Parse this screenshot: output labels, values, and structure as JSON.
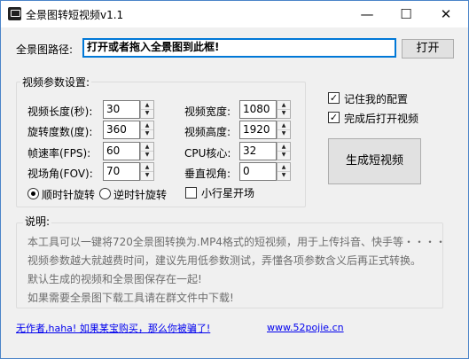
{
  "window": {
    "title": "全景图转短视频v1.1",
    "minimize": "—",
    "maximize": "☐",
    "close": "✕"
  },
  "path": {
    "label": "全景图路径:",
    "value": "打开或者拖入全景图到此框!",
    "open_button": "打开"
  },
  "params": {
    "title": "视频参数设置:",
    "video_length": {
      "label": "视频长度(秒):",
      "value": "30"
    },
    "rotation": {
      "label": "旋转度数(度):",
      "value": "360"
    },
    "fps": {
      "label": "帧速率(FPS):",
      "value": "60"
    },
    "fov": {
      "label": "视场角(FOV):",
      "value": "70"
    },
    "video_width": {
      "label": "视频宽度:",
      "value": "1080"
    },
    "video_height": {
      "label": "视频高度:",
      "value": "1920"
    },
    "cpu_cores": {
      "label": "CPU核心:",
      "value": "32"
    },
    "vertical_angle": {
      "label": "垂直视角:",
      "value": "0"
    },
    "clockwise": "顺时针旋转",
    "counterclockwise": "逆时针旋转",
    "little_planet": "小行星开场",
    "selected_direction": "clockwise"
  },
  "options": {
    "remember_config": {
      "label": "记住我的配置",
      "checked": true
    },
    "open_after": {
      "label": "完成后打开视频",
      "checked": true
    }
  },
  "generate_button": "生成短视频",
  "description": {
    "title": "说明:",
    "lines": [
      "本工具可以一键将720全景图转换为.MP4格式的短视频，用于上传抖音、快手等・・・・",
      "视频参数越大就越费时间，建议先用低参数测试，弄懂各项参数含义后再正式转换。",
      "默认生成的视频和全景图保存在一起!",
      "如果需要全景图下载工具请在群文件中下载!"
    ]
  },
  "footer": {
    "link_left": "无作者,haha! 如果某宝购买，那么你被骗了!",
    "link_right": "www.52pojie.cn"
  },
  "icons": {
    "spin_up": "up-arrow-icon",
    "spin_down": "down-arrow-icon",
    "check": "checkmark-icon"
  }
}
